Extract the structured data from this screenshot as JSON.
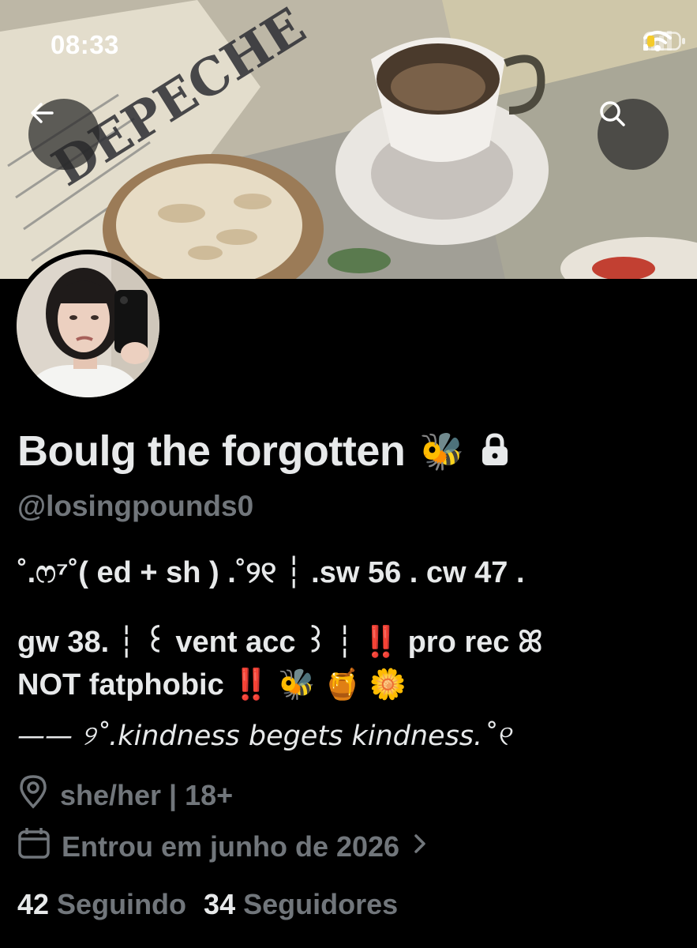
{
  "status_bar": {
    "time": "08:33",
    "icons": [
      "signal-icon",
      "wifi-icon",
      "battery-icon"
    ]
  },
  "header": {
    "back_icon": "arrow-left-icon",
    "search_icon": "search-icon"
  },
  "profile": {
    "display_name": "Boulg the forgotten",
    "name_emoji": "🐝",
    "lock_icon": "lock-icon",
    "handle": "@losingpounds0",
    "bio": [
      "˚.ෆ⁷˚( ed + sh ) .˚୨୧ ┆ .sw 56 . cw 47 .",
      "gw 38. ┆ ꒰ vent acc ꒱ ┆ ‼️ pro rec ꕤ",
      "NOT fatphobic ‼️ 🐝 🍯 🌼",
      "—— ୨˚.kindness begets kindness.˚୧"
    ],
    "location": "she/her | 18+",
    "joined": "Entrou em junho de 2026",
    "following_count": "42",
    "following_label": "Seguindo",
    "followers_count": "34",
    "followers_label": "Seguidores"
  },
  "colors": {
    "background": "#000000",
    "text_primary": "#e7e9ea",
    "text_secondary": "#71767b"
  }
}
